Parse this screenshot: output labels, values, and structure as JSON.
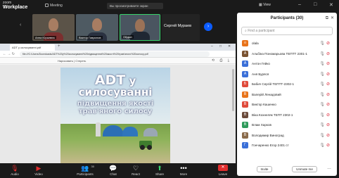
{
  "app": {
    "logo_line1": "zoom",
    "logo_line2": "Workplace",
    "meeting_label": "Meeting",
    "share_banner": "Вы просматриваете экран",
    "view_label": "View",
    "win_min": "–",
    "win_max": "□",
    "win_close": "✕"
  },
  "videos": [
    {
      "name": "Анна Юрьевна"
    },
    {
      "name": "Виктор Гаврилов"
    },
    {
      "name": "Ойдын"
    }
  ],
  "speaker_tile": {
    "name": "Сергей Мураев"
  },
  "strip_next": "›",
  "strip_prev": "‹",
  "browser": {
    "tab_title": "ADT у силосуванні.pdf",
    "tab_plus": "+",
    "url": "file:///C:/Users/Downloads/ADT%20у%20силосуванні%20підвищення%20якості%20трав'яного%20силосу.pdf",
    "nav": "← → ↻",
    "pdf_toolbar": "Нарисовать  |  Стереть",
    "pdf_icons": "⟲ ⎙ ⤓"
  },
  "pdf": {
    "title_prefix": "ADT",
    "title_rest": " у силосуванні",
    "subtitle1": "підвищення якості",
    "subtitle2": "трав'яного силосу"
  },
  "toolbar": {
    "audio": "Audio",
    "video": "Video",
    "participants": "Participants",
    "participants_count": "30",
    "chat": "Chat",
    "react": "React",
    "share": "Share",
    "more": "More",
    "leave": "Leave"
  },
  "panel": {
    "title": "Participants (30)",
    "search_placeholder": "Find a participant",
    "invite": "Invite",
    "unmute_me": "Unmute me",
    "more": "…",
    "participants": [
      {
        "initial": "o",
        "name": "olala",
        "color": "#e8731a"
      },
      {
        "initial": "А",
        "name": "Альбіна Пономарьова ТЕПТТ 2301-1",
        "color": "#7a5230"
      },
      {
        "initial": "А",
        "name": "Антон Гейко",
        "color": "#3a6fd8"
      },
      {
        "initial": "А",
        "name": "Аня Буряся",
        "color": "#3a6fd8"
      },
      {
        "initial": "Б",
        "name": "Бабич Сергій ТЕПТТ-2302-1",
        "color": "#e04a3a"
      },
      {
        "initial": "В",
        "name": "Валерій Ленадовий",
        "color": "#e8731a"
      },
      {
        "initial": "В",
        "name": "Виктор Кашенко",
        "color": "#e04a3a"
      },
      {
        "initial": "В",
        "name": "Віка Кохнеляк ТЕПТ 2302-1",
        "color": "#6b4a3a"
      },
      {
        "initial": "В",
        "name": "Влам Харков",
        "color": "#2e9a5a"
      },
      {
        "initial": "В",
        "name": "Володимир Виноград",
        "color": "#8a6a4a"
      },
      {
        "initial": "Г",
        "name": "Гончаренко Егор 2401 ст",
        "color": "#3a6fd8"
      }
    ]
  }
}
